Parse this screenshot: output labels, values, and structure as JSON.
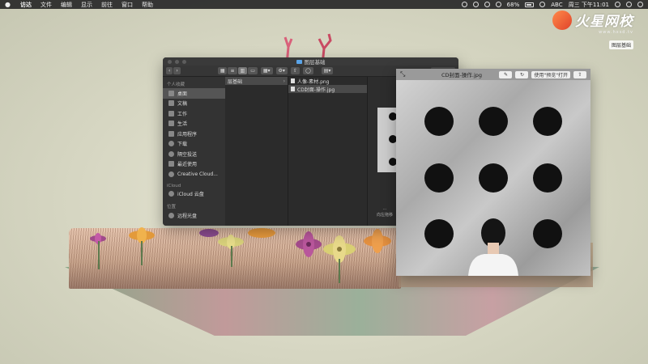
{
  "menubar": {
    "app": "访达",
    "items": [
      "文件",
      "编辑",
      "显示",
      "前往",
      "窗口",
      "帮助"
    ],
    "battery": "68%",
    "input_method": "ABC",
    "clock": "周三 下午11:01"
  },
  "watermark": {
    "logo": "火星网校",
    "domain": "www.hxsd.tv",
    "tag": "图层基础"
  },
  "finder": {
    "title": "图层基础",
    "sidebar": {
      "favorites_header": "个人收藏",
      "favorites": [
        "桌面",
        "文稿",
        "工作",
        "生活",
        "应用程序",
        "下载",
        "隔空投送",
        "最近使用",
        "Creative Cloud..."
      ],
      "icloud_header": "iCloud",
      "icloud": [
        "iCloud 云盘"
      ],
      "locations_header": "位置",
      "locations": [
        "远程光盘"
      ]
    },
    "column1": [
      "层基础"
    ],
    "column2": [
      "人像-素材.png",
      "CD封面-操作.jpg"
    ],
    "preview_more": "向左拖移"
  },
  "quicklook": {
    "title": "CD封面-操作.jpg",
    "open_with": "使用\"预览\"打开",
    "close_glyph": "⤡"
  }
}
